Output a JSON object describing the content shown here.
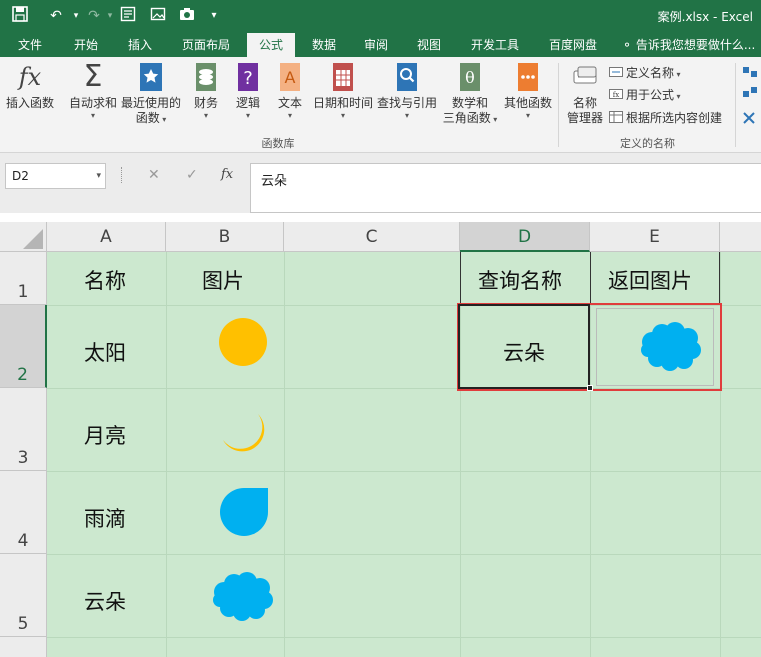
{
  "window": {
    "title": "案例.xlsx - Excel"
  },
  "tabs": [
    {
      "label": "文件",
      "active": false
    },
    {
      "label": "开始",
      "active": false
    },
    {
      "label": "插入",
      "active": false
    },
    {
      "label": "页面布局",
      "active": false
    },
    {
      "label": "公式",
      "active": true
    },
    {
      "label": "数据",
      "active": false
    },
    {
      "label": "审阅",
      "active": false
    },
    {
      "label": "视图",
      "active": false
    },
    {
      "label": "开发工具",
      "active": false
    },
    {
      "label": "百度网盘",
      "active": false
    }
  ],
  "tell_me": "告诉我您想要做什么...",
  "ribbon": {
    "insert_function": "插入函数",
    "autosum": "自动求和",
    "recent_1": "最近使用的",
    "recent_2": "函数",
    "financial": "财务",
    "logical": "逻辑",
    "text": "文本",
    "datetime": "日期和时间",
    "lookup": "查找与引用",
    "math_1": "数学和",
    "math_2": "三角函数",
    "more": "其他函数",
    "library_label": "函数库",
    "name_manager_1": "名称",
    "name_manager_2": "管理器",
    "define_name": "定义名称",
    "use_in_formula": "用于公式",
    "create_from_selection": "根据所选内容创建",
    "defined_names_label": "定义的名称"
  },
  "formula_bar": {
    "name_box": "D2",
    "cancel": "✕",
    "enter": "✓",
    "fx": "fx",
    "value": "云朵"
  },
  "columns": [
    "A",
    "B",
    "C",
    "D",
    "E"
  ],
  "rows": [
    "1",
    "2",
    "3",
    "4",
    "5"
  ],
  "cells": {
    "A1": "名称",
    "B1": "图片",
    "D1": "查询名称",
    "E1": "返回图片",
    "A2": "太阳",
    "A3": "月亮",
    "A4": "雨滴",
    "A5": "云朵",
    "D2": "云朵"
  },
  "images": {
    "B2": "sun-icon",
    "B3": "moon-icon",
    "B4": "raindrop-icon",
    "B5": "cloud-icon",
    "E2": "cloud-icon"
  },
  "colors": {
    "excel_green": "#217346",
    "sheet_bg": "#cce8cf",
    "sun": "#ffc000",
    "shape_blue": "#00b0f0",
    "highlight_red": "#e03c3c"
  }
}
